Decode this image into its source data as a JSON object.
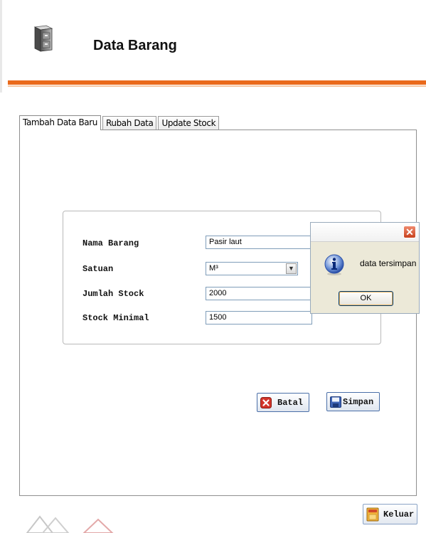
{
  "header": {
    "title": "Data Barang",
    "accent": "#ea6a1b"
  },
  "tabs": [
    {
      "label": "Tambah Data Baru",
      "active": true
    },
    {
      "label": "Rubah Data",
      "active": false
    },
    {
      "label": "Update Stock",
      "active": false
    }
  ],
  "form": {
    "nama_barang": {
      "label": "Nama Barang",
      "value": "Pasir laut"
    },
    "satuan": {
      "label": "Satuan",
      "value": "M³"
    },
    "jumlah_stock": {
      "label": "Jumlah Stock",
      "value": "2000"
    },
    "stock_minimal": {
      "label": "Stock Minimal",
      "value": "1500"
    }
  },
  "buttons": {
    "batal": "Batal",
    "simpan": "Simpan",
    "keluar": "Keluar"
  },
  "dialog": {
    "message": "data tersimpan",
    "ok": "OK",
    "close": "✕"
  },
  "icons": [
    "cabinet-icon",
    "cancel-icon",
    "save-icon",
    "exit-icon",
    "info-icon",
    "close-icon",
    "chevron-down-icon"
  ]
}
